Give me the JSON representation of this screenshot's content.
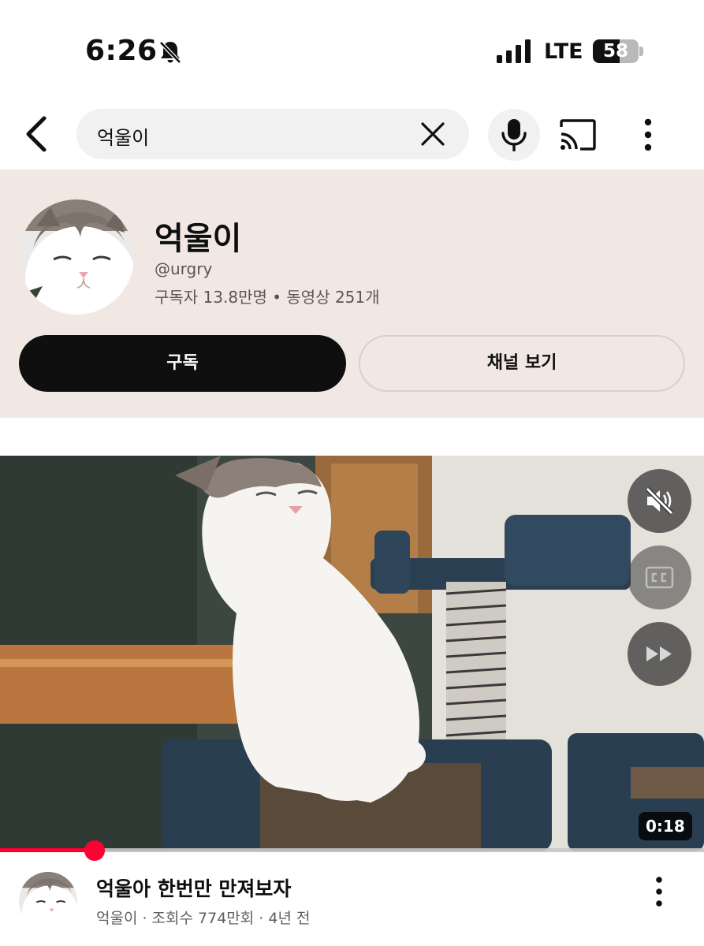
{
  "status_bar": {
    "time": "6:26",
    "network": "LTE",
    "battery": "58",
    "battery_level": 0.58,
    "icons": [
      "bell-slash-icon",
      "signal-icon",
      "battery-icon"
    ]
  },
  "search": {
    "query": "억울이",
    "icons": [
      "back-icon",
      "clear-icon",
      "mic-icon",
      "cast-icon",
      "more-vert-icon"
    ]
  },
  "channel": {
    "name": "억울이",
    "handle": "@urgry",
    "stats": "구독자 13.8만명 • 동영상 251개",
    "subscribe_label": "구독",
    "view_channel_label": "채널 보기"
  },
  "video": {
    "duration": "0:18",
    "progress_fraction": 0.134,
    "controls": [
      "mute-icon",
      "captions-icon",
      "fast-forward-icon"
    ],
    "title": "억울아 한번만 만져보자",
    "meta": "억울이 · 조회수 774만회 · 4년 전"
  },
  "colors": {
    "channel_card_bg": "#f1e8e4",
    "accent_red": "#ff0033",
    "subscribe_bg": "#0f0f0f"
  }
}
